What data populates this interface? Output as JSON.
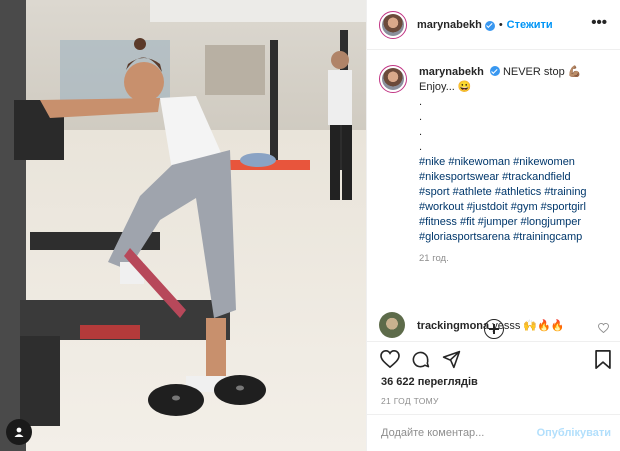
{
  "post": {
    "username": "marynabekh",
    "follow_label": "Стежити",
    "header_separator": "•",
    "more_icon": "more-horizontal-icon",
    "caption": {
      "text": "NEVER stop 💪🏽 Enjoy... 😀",
      "dots": [
        ".",
        ".",
        ".",
        "."
      ],
      "hashtags": "#nike #nikewoman #nikewomen #nikesportswear #trackandfield #sport #athlete #athletics #training #workout #justdoit #gym #sportgirl #fitness #fit #jumper #longjumper #gloriasportsarena #trainingcamp",
      "time": "21 год."
    },
    "reply": {
      "username": "trackingmona",
      "text": "yesss 🙌🔥🔥"
    },
    "views": "36 622 переглядів",
    "posted": "21 ГОД ТОМУ",
    "comment_input": {
      "placeholder": "Додайте коментар...",
      "value": ""
    },
    "publish_label": "Опублікувати"
  },
  "colors": {
    "accent": "#0095f6",
    "verified": "#3897f0",
    "hashtag": "#00376b",
    "publish_disabled": "#b2dffc",
    "muted": "#8e8e8e"
  },
  "icons": [
    "verified-badge-icon",
    "more-horizontal-icon",
    "add-circle-icon",
    "heart-icon",
    "comment-icon",
    "share-icon",
    "bookmark-icon",
    "user-tag-icon"
  ]
}
